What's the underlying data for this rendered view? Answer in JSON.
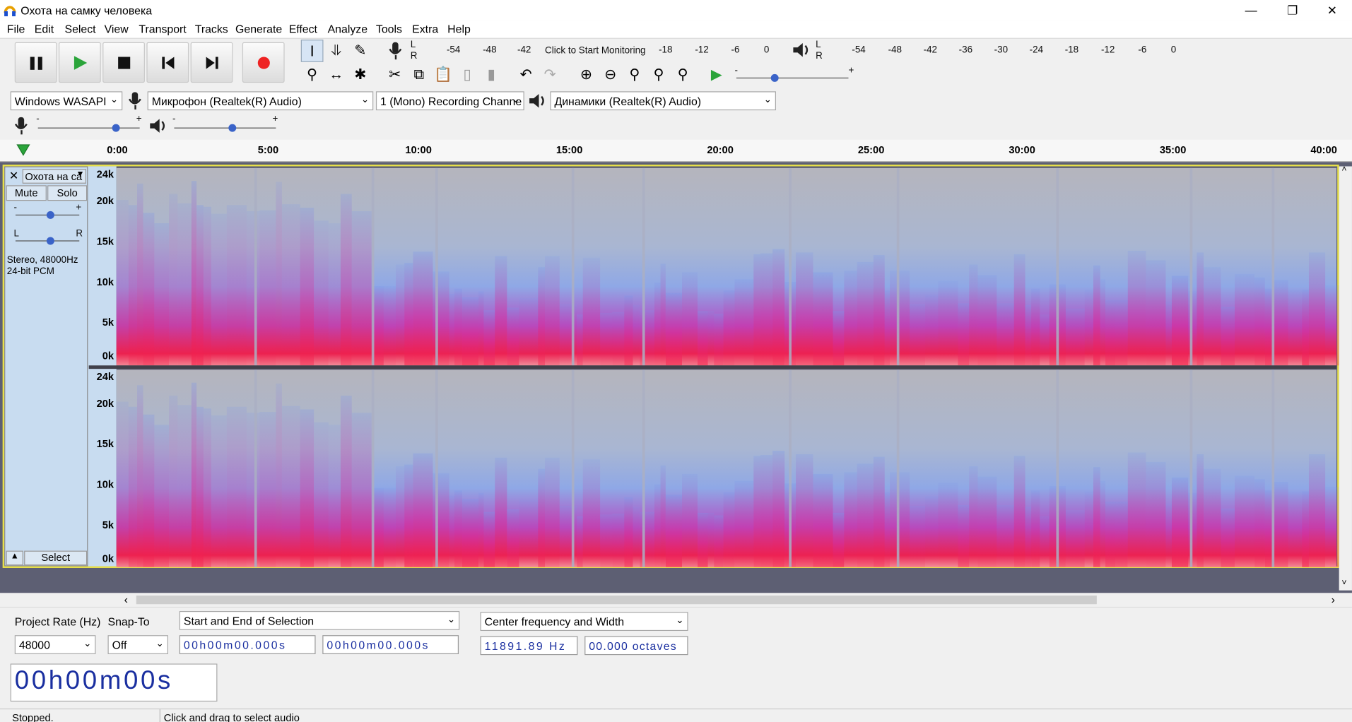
{
  "window": {
    "title": "Охота на самку человека"
  },
  "menu": [
    "File",
    "Edit",
    "Select",
    "View",
    "Transport",
    "Tracks",
    "Generate",
    "Effect",
    "Analyze",
    "Tools",
    "Extra",
    "Help"
  ],
  "meter": {
    "lr": [
      "L",
      "R"
    ],
    "rec_ticks": [
      "-54",
      "-48",
      "-42",
      "Click to Start Monitoring",
      "-18",
      "-12",
      "-6",
      "0"
    ],
    "play_ticks": [
      "-54",
      "-48",
      "-42",
      "-36",
      "-30",
      "-24",
      "-18",
      "-12",
      "-6",
      "0"
    ]
  },
  "device": {
    "host": "Windows WASAPI",
    "mic": "Микрофон (Realtek(R) Audio)",
    "channels": "1 (Mono) Recording Channe",
    "speaker": "Динамики (Realtek(R) Audio)"
  },
  "ruler": {
    "labels": [
      "0:00",
      "5:00",
      "10:00",
      "15:00",
      "20:00",
      "25:00",
      "30:00",
      "35:00",
      "40:00"
    ]
  },
  "track": {
    "name": "Охота на са",
    "mute": "Mute",
    "solo": "Solo",
    "gain_minus": "-",
    "gain_plus": "+",
    "pan_l": "L",
    "pan_r": "R",
    "info1": "Stereo, 48000Hz",
    "info2": "24-bit PCM",
    "select": "Select",
    "yaxis": [
      "24k",
      "20k",
      "15k",
      "10k",
      "5k",
      "0k"
    ]
  },
  "selection_bar": {
    "project_rate_label": "Project Rate (Hz)",
    "snap_label": "Snap-To",
    "rate": "48000",
    "snap": "Off",
    "sel_mode": "Start and End of Selection",
    "start": "00h00m00.000s",
    "end": "00h00m00.000s",
    "spectral_mode": "Center frequency and Width",
    "center": "11891.89 Hz",
    "width": "00.000 octaves"
  },
  "timer": "00h00m00s",
  "status": {
    "state": "Stopped.",
    "hint": "Click and drag to select audio"
  }
}
